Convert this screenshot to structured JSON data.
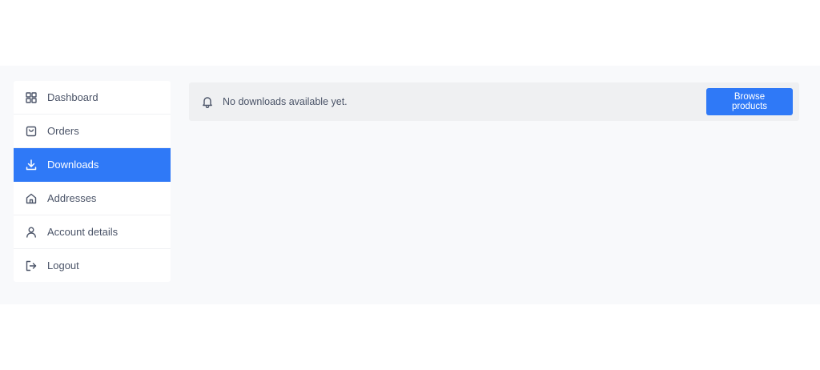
{
  "sidebar": {
    "items": [
      {
        "label": "Dashboard",
        "icon": "grid-icon",
        "active": false
      },
      {
        "label": "Orders",
        "icon": "bag-icon",
        "active": false
      },
      {
        "label": "Downloads",
        "icon": "download-icon",
        "active": true
      },
      {
        "label": "Addresses",
        "icon": "home-icon",
        "active": false
      },
      {
        "label": "Account details",
        "icon": "user-icon",
        "active": false
      },
      {
        "label": "Logout",
        "icon": "logout-icon",
        "active": false
      }
    ]
  },
  "notice": {
    "icon": "bell-icon",
    "message": "No downloads available yet.",
    "button_label": "Browse products"
  },
  "colors": {
    "accent": "#2f79f7",
    "text": "#4b5468",
    "notice_bg": "#eff0f2",
    "page_bg": "#f8f9fb"
  }
}
